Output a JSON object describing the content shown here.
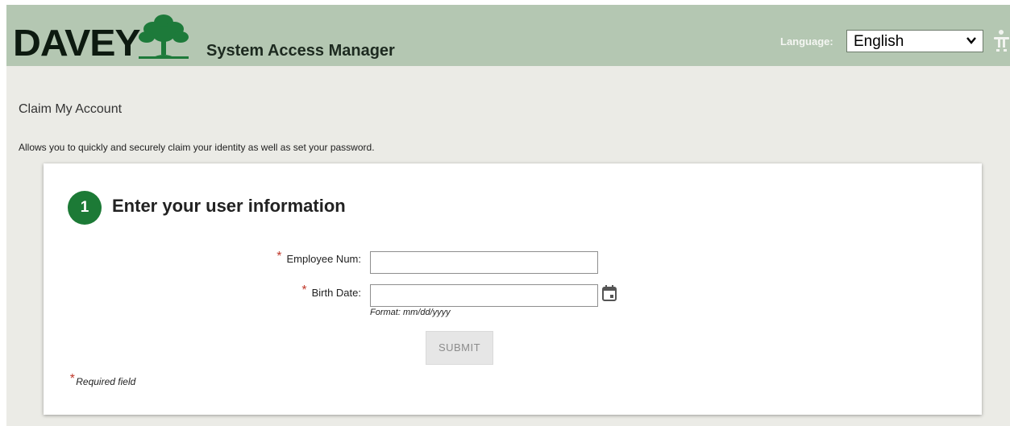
{
  "header": {
    "logo_text": "DAVEY",
    "app_title": "System Access Manager",
    "language_label": "Language:",
    "language_selected": "English"
  },
  "page": {
    "title": "Claim My Account",
    "description": "Allows you to quickly and securely claim your identity as well as set your password."
  },
  "form": {
    "step_number": "1",
    "step_title": "Enter your user information",
    "required_mark": "*",
    "employee_label": "Employee Num:",
    "employee_value": "",
    "birth_label": "Birth Date:",
    "birth_value": "",
    "birth_hint": "Format: mm/dd/yyyy",
    "submit_label": "SUBMIT",
    "required_note": "Required field"
  },
  "colors": {
    "header_bg": "#b4c7b2",
    "page_bg": "#ebebe6",
    "accent_green": "#1c7a36",
    "required_red": "#c0392b"
  },
  "icons": [
    "tree-logo-icon",
    "chevron-down-icon",
    "accessibility-icon",
    "calendar-icon"
  ]
}
